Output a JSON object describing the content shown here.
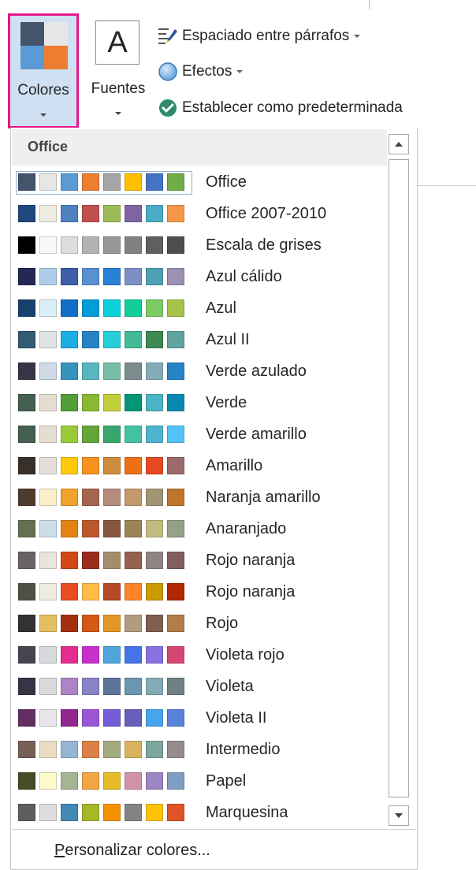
{
  "ribbon": {
    "colores_label": "Colores",
    "fuentes_label": "Fuentes",
    "fuentes_glyph": "A",
    "colores_icon_colors": [
      "#44546a",
      "#e7e6e6",
      "#5b9bd5",
      "#ed7d31"
    ],
    "highlight_color": "#e5178a",
    "spacing_label": "Espaciado entre párrafos",
    "effects_label": "Efectos",
    "default_label": "Establecer como predeterminada"
  },
  "gallery": {
    "header": "Office",
    "themes": [
      {
        "name": "Office",
        "colors": [
          "#44546a",
          "#e7e6e6",
          "#5b9bd5",
          "#ed7d31",
          "#a5a5a5",
          "#ffc000",
          "#4472c4",
          "#70ad47"
        ]
      },
      {
        "name": "Office 2007-2010",
        "colors": [
          "#1f497d",
          "#eeece1",
          "#4f81bd",
          "#c0504d",
          "#9bbb59",
          "#8064a2",
          "#4bacc6",
          "#f79646"
        ]
      },
      {
        "name": "Escala de grises",
        "colors": [
          "#000000",
          "#f8f8f8",
          "#dddddd",
          "#b2b2b2",
          "#969696",
          "#808080",
          "#5f5f5f",
          "#4d4d4d"
        ]
      },
      {
        "name": "Azul cálido",
        "colors": [
          "#242852",
          "#acccea",
          "#3e5eaa",
          "#5b90d0",
          "#2a80d6",
          "#7d8fc4",
          "#4fa0b3",
          "#9c91b5"
        ]
      },
      {
        "name": "Azul",
        "colors": [
          "#17406d",
          "#dbeff9",
          "#0f6fc6",
          "#009dd9",
          "#0bd0d9",
          "#10cf9b",
          "#7cca62",
          "#a5c249"
        ]
      },
      {
        "name": "Azul II",
        "colors": [
          "#335b74",
          "#dfe3e5",
          "#1cade4",
          "#2683c6",
          "#27ced7",
          "#42ba97",
          "#3e8853",
          "#62a39f"
        ]
      },
      {
        "name": "Verde azulado",
        "colors": [
          "#373545",
          "#cedbe6",
          "#3494ba",
          "#58b6c0",
          "#75bda7",
          "#7a8c8e",
          "#84acb6",
          "#2683c6"
        ]
      },
      {
        "name": "Verde",
        "colors": [
          "#455f51",
          "#e3ded1",
          "#549e39",
          "#8ab833",
          "#c0cf3a",
          "#029676",
          "#4ab5c4",
          "#0989b1"
        ]
      },
      {
        "name": "Verde amarillo",
        "colors": [
          "#455f51",
          "#e3ded1",
          "#99cb38",
          "#63a537",
          "#37a76f",
          "#44c1a3",
          "#4eb3cf",
          "#51c3f9"
        ]
      },
      {
        "name": "Amarillo",
        "colors": [
          "#39302a",
          "#e5dedb",
          "#ffca08",
          "#f8931d",
          "#ce8d3e",
          "#ec7016",
          "#e64823",
          "#9c6a6a"
        ]
      },
      {
        "name": "Naranja amarillo",
        "colors": [
          "#4e3b30",
          "#fbeec9",
          "#f0a22e",
          "#a5644e",
          "#b58b80",
          "#c3986d",
          "#a19574",
          "#c17529"
        ]
      },
      {
        "name": "Anaranjado",
        "colors": [
          "#637052",
          "#ccddea",
          "#e48312",
          "#bd582c",
          "#865640",
          "#9b8357",
          "#c2bc80",
          "#94a088"
        ]
      },
      {
        "name": "Rojo naranja",
        "colors": [
          "#696464",
          "#e9e5dc",
          "#d34817",
          "#9b2d1f",
          "#a28e6a",
          "#956251",
          "#918485",
          "#855d5d"
        ]
      },
      {
        "name": "Rojo naranja",
        "colors": [
          "#505046",
          "#eeece1",
          "#e84c22",
          "#ffbd47",
          "#b64926",
          "#ff8427",
          "#cc9900",
          "#b22600"
        ]
      },
      {
        "name": "Rojo",
        "colors": [
          "#323232",
          "#e3c05f",
          "#a5300f",
          "#d55816",
          "#e19825",
          "#b19c7d",
          "#7f5f52",
          "#b27d49"
        ]
      },
      {
        "name": "Violeta rojo",
        "colors": [
          "#454551",
          "#d8d9dc",
          "#e32d91",
          "#c830cc",
          "#4ea6dc",
          "#4775e7",
          "#8971e1",
          "#d54773"
        ]
      },
      {
        "name": "Violeta",
        "colors": [
          "#373545",
          "#dcd8dc",
          "#ad84c6",
          "#8784c7",
          "#5d739a",
          "#6997af",
          "#84acb6",
          "#6f8183"
        ]
      },
      {
        "name": "Violeta II",
        "colors": [
          "#632e62",
          "#eae5eb",
          "#92278f",
          "#9b57d3",
          "#755dd9",
          "#665eb8",
          "#45a5ed",
          "#5982db"
        ]
      },
      {
        "name": "Intermedio",
        "colors": [
          "#775f55",
          "#ebddc3",
          "#94b6d2",
          "#dd8047",
          "#a5ab81",
          "#d8b25c",
          "#7ba79d",
          "#968c8c"
        ]
      },
      {
        "name": "Papel",
        "colors": [
          "#444d26",
          "#fefac9",
          "#a5b592",
          "#f3a447",
          "#e7bc29",
          "#d092a7",
          "#9c85c0",
          "#809ec2"
        ]
      },
      {
        "name": "Marquesina",
        "colors": [
          "#5e5e5e",
          "#dddddd",
          "#418ab3",
          "#a6b727",
          "#f69200",
          "#838383",
          "#fec306",
          "#df5327"
        ]
      }
    ],
    "footer_prefix": "P",
    "footer_rest": "ersonalizar colores..."
  }
}
